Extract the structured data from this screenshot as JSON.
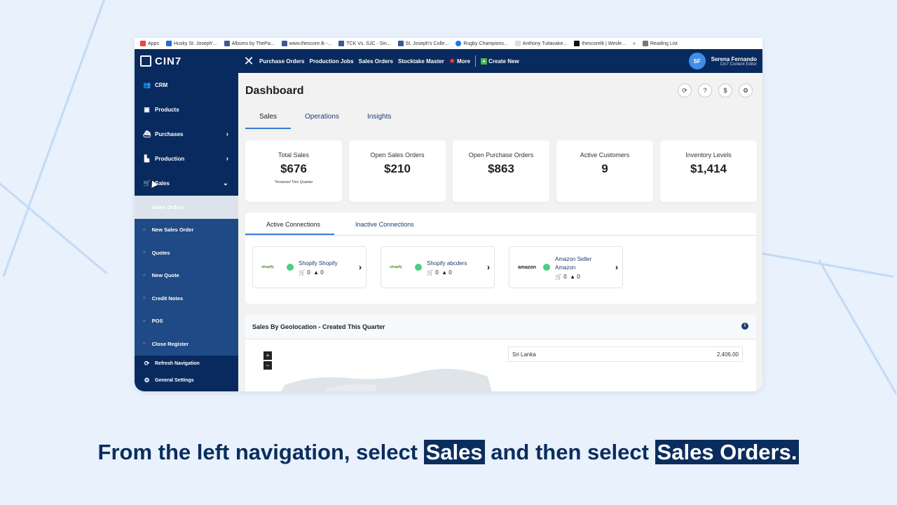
{
  "bookmarks": [
    {
      "label": "Apps",
      "icon": "apps-grid-icon"
    },
    {
      "label": "Husky St. Joseph'...",
      "icon": "bookmark-icon"
    },
    {
      "label": "Albums by ThePa...",
      "icon": "facebook-icon"
    },
    {
      "label": "www.thescore.lk -...",
      "icon": "facebook-icon"
    },
    {
      "label": "TCK Vs. SJC - Sin...",
      "icon": "facebook-icon"
    },
    {
      "label": "St. Joseph's Colle...",
      "icon": "facebook-icon"
    },
    {
      "label": "Rugby Champions...",
      "icon": "facebook-icon"
    },
    {
      "label": "Anthony Tuitavake...",
      "icon": "wikipedia-icon"
    },
    {
      "label": "thescorelk | Wesle...",
      "icon": "t-icon"
    },
    {
      "label": "»",
      "icon": ""
    },
    {
      "label": "Reading List",
      "icon": "reading-list-icon"
    }
  ],
  "topbar": {
    "logo": "CIN7",
    "nav": [
      "Purchase Orders",
      "Production Jobs",
      "Sales Orders",
      "Stocktake Master",
      "More",
      "Create New"
    ],
    "user": {
      "initials": "SF",
      "name": "Serena Fernando",
      "role": "Cin7 Content Editor"
    }
  },
  "sidebar": {
    "items": [
      {
        "label": "CRM",
        "icon": "users-icon"
      },
      {
        "label": "Products",
        "icon": "box-icon"
      },
      {
        "label": "Purchases",
        "icon": "ship-icon"
      },
      {
        "label": "Production",
        "icon": "factory-icon"
      },
      {
        "label": "Sales",
        "icon": "cart-icon"
      }
    ],
    "sub_items": [
      "Sales Orders",
      "New Sales Order",
      "Quotes",
      "New Quote",
      "Credit Notes",
      "POS",
      "Close Register"
    ],
    "footer": [
      "Refresh Navigation",
      "General Settings"
    ]
  },
  "main": {
    "title": "Dashboard",
    "tabs": [
      "Sales",
      "Operations",
      "Insights"
    ],
    "cards": [
      {
        "label": "Total Sales",
        "value": "$676",
        "note": "*Invoiced This Quarter"
      },
      {
        "label": "Open Sales Orders",
        "value": "$210",
        "note": ""
      },
      {
        "label": "Open Purchase Orders",
        "value": "$863",
        "note": ""
      },
      {
        "label": "Active Customers",
        "value": "9",
        "note": ""
      },
      {
        "label": "Inventory Levels",
        "value": "$1,414",
        "note": ""
      }
    ],
    "connection_tabs": [
      "Active Connections",
      "Inactive Connections"
    ],
    "connections": [
      {
        "logo": "shopify",
        "name1": "Shopify Shopify",
        "name2": "",
        "orders": "0",
        "warnings": "0"
      },
      {
        "logo": "shopify",
        "name1": "Shopify abcders",
        "name2": "",
        "orders": "0",
        "warnings": "0"
      },
      {
        "logo": "amazon",
        "name1": "Amazon Seller",
        "name2": "Amazon",
        "orders": "0",
        "warnings": "0"
      }
    ],
    "geo": {
      "title": "Sales By Geolocation - Created This Quarter",
      "rows": [
        {
          "country": "Sri Lanka",
          "value": "2,406.00"
        }
      ]
    }
  },
  "caption": {
    "part1": "From the left navigation, select ",
    "hl1": "Sales",
    "part2": " and then select ",
    "hl2": "Sales Orders."
  }
}
